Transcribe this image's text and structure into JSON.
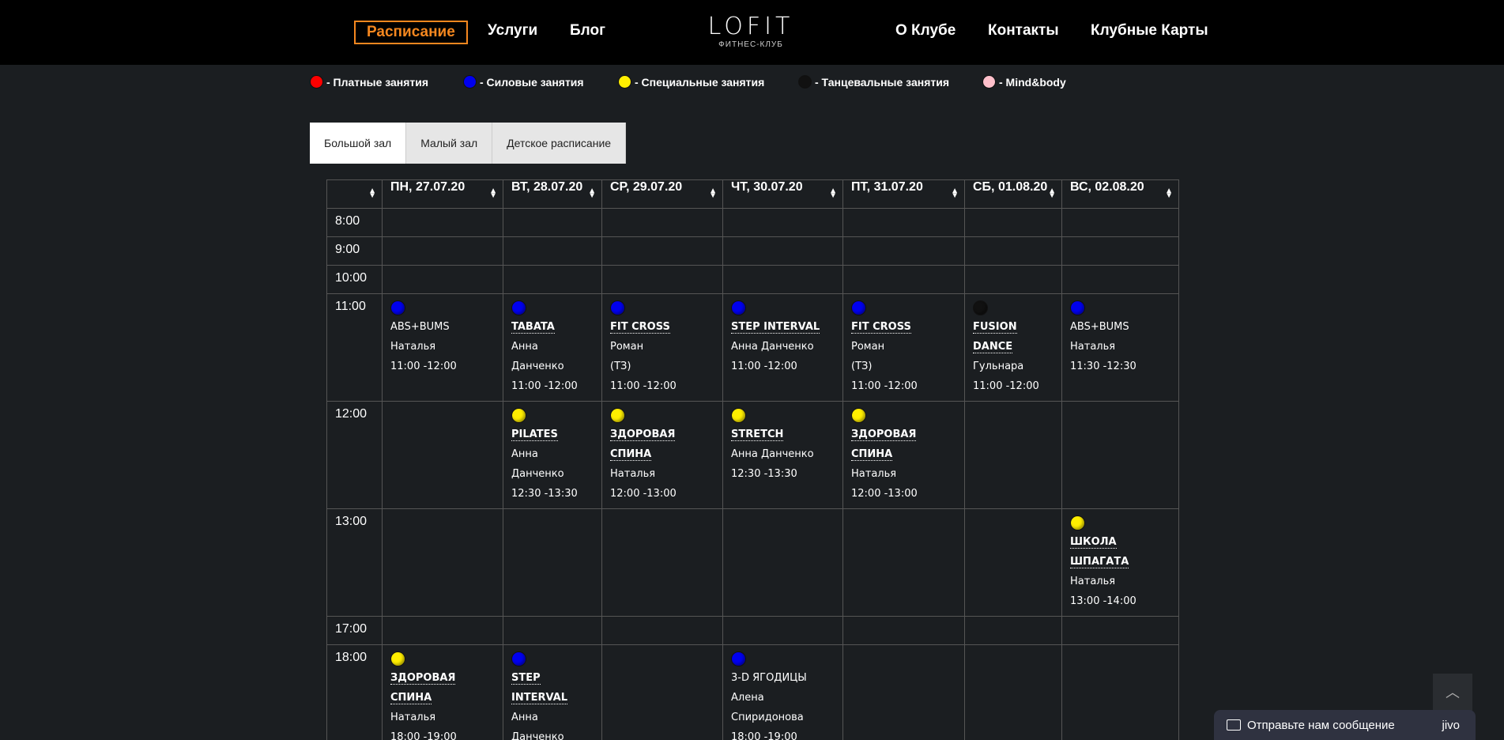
{
  "nav": {
    "left": [
      "Расписание",
      "Услуги",
      "Блог"
    ],
    "right": [
      "О Клубе",
      "Контакты",
      "Клубные Карты"
    ],
    "logo": "LOFIT",
    "logo_sub": "ФИТНЕС-КЛУБ"
  },
  "legend": [
    {
      "color": "#ff0000",
      "label": "- Платные занятия"
    },
    {
      "color": "#0000ee",
      "label": "- Силовые занятия"
    },
    {
      "color": "#ffee00",
      "label": "- Специальные занятия"
    },
    {
      "color": "#111111",
      "label": "- Танцевальные занятия"
    },
    {
      "color": "#ffc0cb",
      "label": "- Mind&body"
    }
  ],
  "tabs": [
    "Большой зал",
    "Малый зал",
    "Детское расписание"
  ],
  "schedule": {
    "days": [
      "ПН, 27.07.20",
      "ВТ, 28.07.20",
      "СР, 29.07.20",
      "ЧТ, 30.07.20",
      "ПТ, 31.07.20",
      "СБ, 01.08.20",
      "ВС, 02.08.20"
    ],
    "rows": [
      {
        "time": "8:00"
      },
      {
        "time": "9:00"
      },
      {
        "time": "10:00"
      },
      {
        "time": "11:00"
      },
      {
        "time": "12:00"
      },
      {
        "time": "13:00"
      },
      {
        "time": "17:00"
      },
      {
        "time": "18:00"
      }
    ],
    "events": {
      "r11": [
        {
          "color": "#0000ee",
          "title": "ABS+BUMS",
          "link": false,
          "lines": [
            "Наталья",
            "11:00 -12:00"
          ]
        },
        {
          "color": "#0000ee",
          "title": "TABATA",
          "link": true,
          "lines": [
            "Анна",
            "Данченко",
            "11:00 -12:00"
          ]
        },
        {
          "color": "#0000ee",
          "title": "FIT CROSS",
          "link": true,
          "lines": [
            "Роман",
            "(ТЗ)",
            "11:00 -12:00"
          ]
        },
        {
          "color": "#0000ee",
          "title": "STEP INTERVAL",
          "link": true,
          "lines": [
            "Анна Данченко",
            "11:00 -12:00"
          ]
        },
        {
          "color": "#0000ee",
          "title": "FIT CROSS",
          "link": true,
          "lines": [
            "Роман",
            "(ТЗ)",
            "11:00 -12:00"
          ]
        },
        {
          "color": "#111111",
          "title": "FUSION DANCE",
          "link": true,
          "lines": [
            "Гульнара",
            "11:00 -12:00"
          ]
        },
        {
          "color": "#0000ee",
          "title": "ABS+BUMS",
          "link": false,
          "lines": [
            "Наталья",
            "11:30 -12:30"
          ]
        }
      ],
      "r12": [
        null,
        {
          "color": "#ffee00",
          "title": "PILATES",
          "link": true,
          "lines": [
            "Анна",
            "Данченко",
            "12:30 -13:30"
          ]
        },
        {
          "color": "#ffee00",
          "title": "ЗДОРОВАЯ СПИНА",
          "link": true,
          "lines": [
            "Наталья",
            "12:00 -13:00"
          ]
        },
        {
          "color": "#ffee00",
          "title": "STRETCH",
          "link": true,
          "lines": [
            "Анна Данченко",
            "12:30 -13:30"
          ]
        },
        {
          "color": "#ffee00",
          "title": "ЗДОРОВАЯ СПИНА",
          "link": true,
          "lines": [
            "Наталья",
            "12:00 -13:00"
          ]
        },
        null,
        null
      ],
      "r13": [
        null,
        null,
        null,
        null,
        null,
        null,
        {
          "color": "#ffee00",
          "title": "ШКОЛА ШПАГАТА",
          "link": true,
          "lines": [
            "Наталья",
            "13:00 -14:00"
          ]
        }
      ],
      "r18": [
        {
          "color": "#ffee00",
          "title": "ЗДОРОВАЯ СПИНА",
          "link": true,
          "lines": [
            "Наталья",
            "18:00 -19:00"
          ]
        },
        {
          "color": "#0000ee",
          "title": "STEP INTERVAL",
          "link": true,
          "lines": [
            "Анна",
            "Данченко"
          ]
        },
        null,
        {
          "color": "#0000ee",
          "title": "3-D ЯГОДИЦЫ",
          "link": false,
          "lines": [
            "Алена",
            "Спиридонова",
            "18:00 -19:00"
          ]
        },
        null,
        null,
        null
      ]
    }
  },
  "chat": {
    "label": "Отправьте нам сообщение",
    "brand": "jivo"
  },
  "scroll_top_icon": "chevron-up-icon"
}
